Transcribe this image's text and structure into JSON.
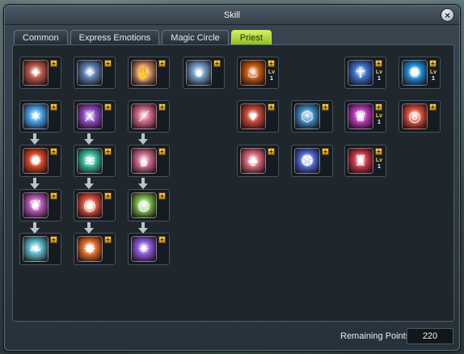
{
  "window": {
    "title": "Skill",
    "close_symbol": "×"
  },
  "tabs": [
    {
      "label": "Common",
      "active": false
    },
    {
      "label": "Express Emotions",
      "active": false
    },
    {
      "label": "Magic Circle",
      "active": false
    },
    {
      "label": "Priest",
      "active": true
    }
  ],
  "skills": {
    "lv_label": "Lv",
    "plus_symbol": "+",
    "row1": [
      {
        "icon": "guardian-figure-icon",
        "color": "#b85a4a"
      },
      {
        "icon": "praying-figure-icon",
        "color": "#5a7fb0"
      },
      {
        "icon": "blessing-hand-icon",
        "color": "#c98a5a"
      },
      {
        "icon": "light-orb-icon",
        "color": "#6f9ac4"
      },
      {
        "icon": "fire-aura-figure-icon",
        "color": "#c25a10",
        "level": "1"
      },
      {
        "icon": "holy-light-figure-icon",
        "color": "#3a6fc8",
        "level": "1"
      },
      {
        "icon": "radiant-figure-icon",
        "color": "#1f8fd8",
        "level": "1"
      }
    ],
    "tree": [
      {
        "icon": "light-burst-icon",
        "color": "#4aa3e8"
      },
      {
        "icon": "holy-sword-icon",
        "color": "#8a4ac0"
      },
      {
        "icon": "slash-strike-icon",
        "color": "#d06a8a"
      },
      {
        "icon": "flame-star-icon",
        "color": "#d84a2a"
      },
      {
        "icon": "green-wave-icon",
        "color": "#3ab8a0"
      },
      {
        "icon": "triple-spiral-icon",
        "color": "#c86a8a"
      },
      {
        "icon": "winged-emblem-icon",
        "color": "#b85ab8"
      },
      {
        "icon": "red-orb-icon",
        "color": "#d8503a"
      },
      {
        "icon": "green-sphere-icon",
        "color": "#7ab84a"
      },
      {
        "icon": "spirit-wing-icon",
        "color": "#5ab8c8"
      },
      {
        "icon": "fire-burst-icon",
        "color": "#e0702a"
      },
      {
        "icon": "purple-nova-icon",
        "color": "#8a5ad8"
      }
    ],
    "right_block": [
      {
        "icon": "heart-icon",
        "color": "#c84a3a"
      },
      {
        "icon": "blue-shield-icon",
        "color": "#3a8ac0"
      },
      {
        "icon": "winged-crest-icon",
        "color": "#b83ab8",
        "level": "1"
      },
      {
        "icon": "red-glow-icon",
        "color": "#d8503a"
      },
      {
        "icon": "holy-tree-icon",
        "color": "#d86a7a"
      },
      {
        "icon": "blue-sigil-icon",
        "color": "#4a6ad8"
      },
      {
        "icon": "white-crest-icon",
        "color": "#c83a4a",
        "level": "1"
      }
    ]
  },
  "footer": {
    "remaining_label": "Remaining Points",
    "remaining_points": "220"
  }
}
